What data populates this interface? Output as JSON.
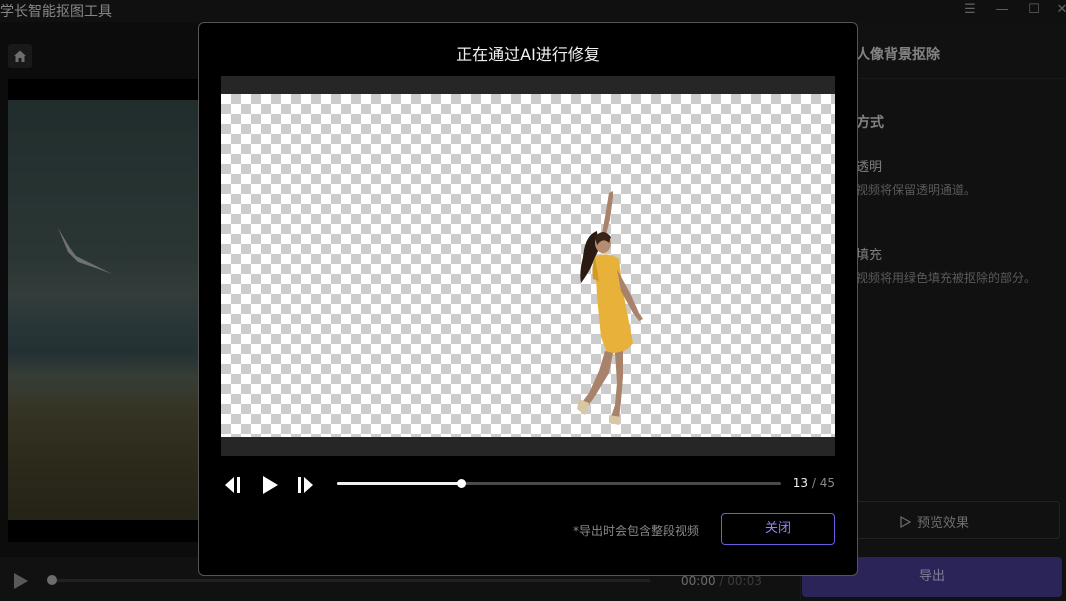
{
  "app": {
    "title": "丰学长智能抠图工具"
  },
  "window_controls": {
    "menu": "☰",
    "minimize": "—",
    "maximize": "☐",
    "close": "✕"
  },
  "player": {
    "current_time": "00:00",
    "separator": " / ",
    "total_time": "00:03"
  },
  "panel": {
    "header": "人像背景抠除",
    "section_title": "方式",
    "option1_title": "透明",
    "option1_desc": "视频将保留透明通道。",
    "option2_title": "填充",
    "option2_desc": "视频将用绿色填充被抠除的部分。",
    "preview_button": "预览效果",
    "export_button": "导出"
  },
  "modal": {
    "title": "正在通过AI进行修复",
    "frame_current": "13",
    "frame_separator": " / ",
    "frame_total": "45",
    "progress": 0.28,
    "export_note": "*导出时会包含整段视频",
    "close_button": "关闭"
  },
  "colors": {
    "accent": "#6a5ce0",
    "export_bg": "#4a3f9a",
    "dress": "#e8b23a"
  }
}
